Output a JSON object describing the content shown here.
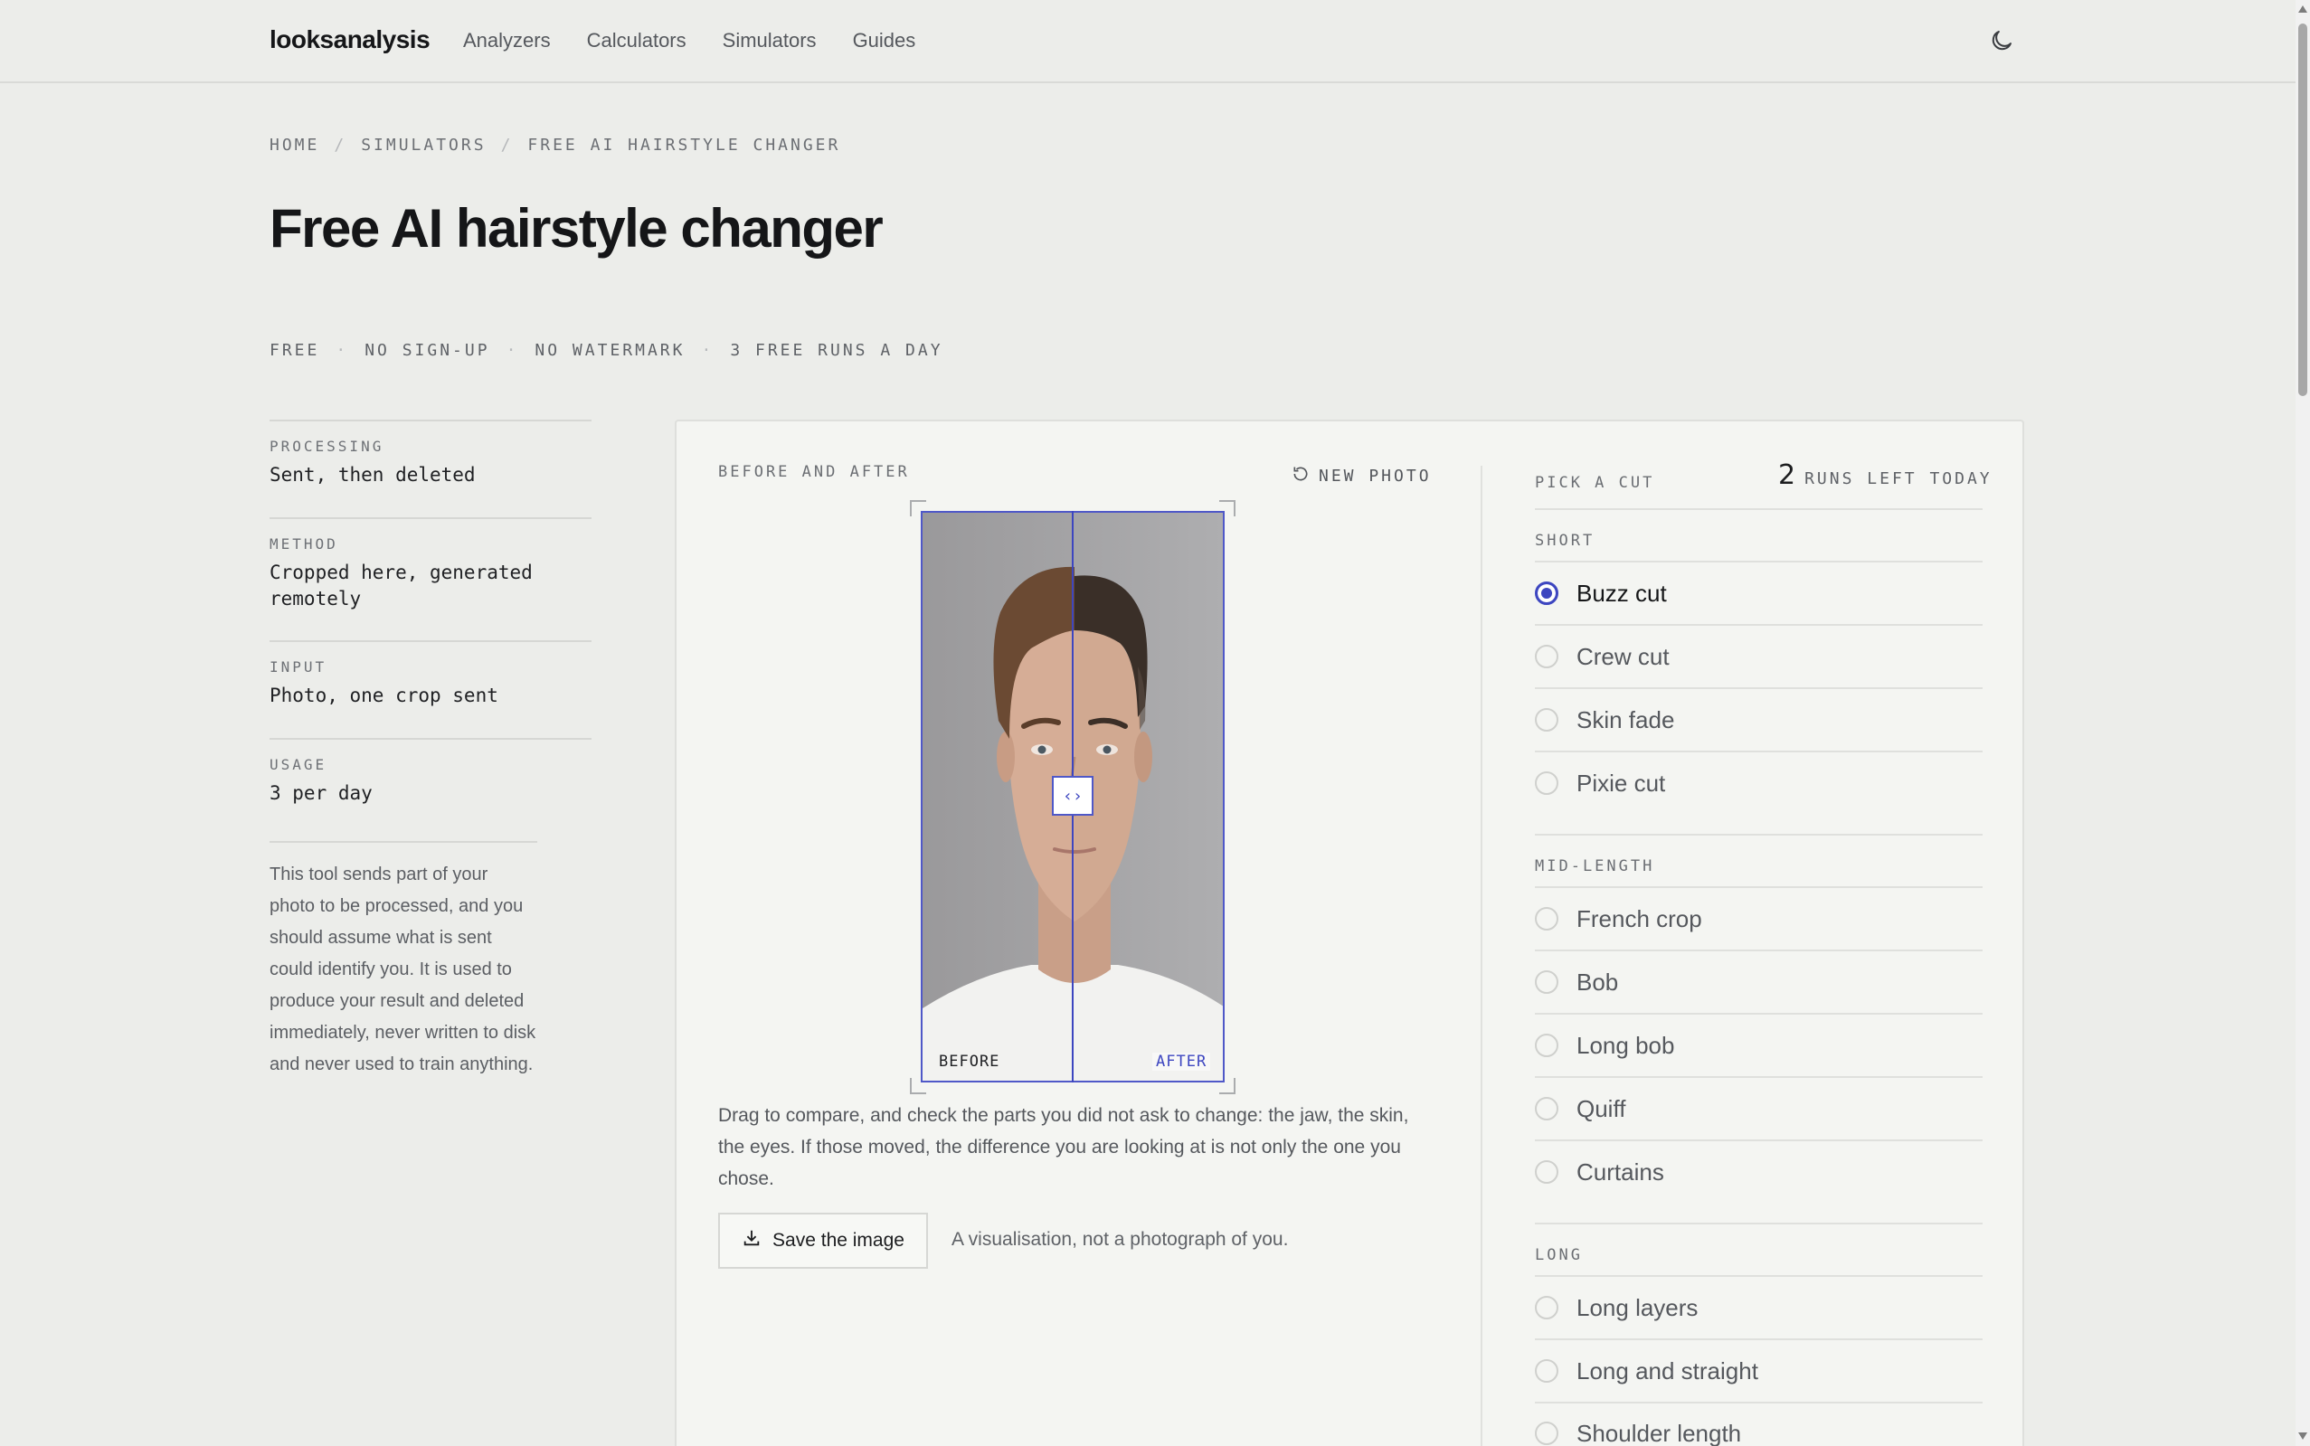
{
  "nav": {
    "logo": "looksanalysis",
    "links": [
      "Analyzers",
      "Calculators",
      "Simulators",
      "Guides"
    ]
  },
  "breadcrumb": [
    "HOME",
    "SIMULATORS",
    "FREE AI HAIRSTYLE CHANGER"
  ],
  "page": {
    "title": "Free AI hairstyle changer",
    "taglines": [
      "FREE",
      "NO SIGN-UP",
      "NO WATERMARK",
      "3 FREE RUNS A DAY"
    ]
  },
  "facts": [
    {
      "label": "PROCESSING",
      "value": "Sent, then deleted"
    },
    {
      "label": "METHOD",
      "value": "Cropped here, generated remotely"
    },
    {
      "label": "INPUT",
      "value": "Photo, one crop sent"
    },
    {
      "label": "USAGE",
      "value": "3 per day"
    }
  ],
  "privacy_note": "This tool sends part of your photo to be processed, and you should assume what is sent could identify you. It is used to produce your result and deleted immediately, never written to disk and never used to train anything.",
  "compare": {
    "section_label": "BEFORE AND AFTER",
    "new_photo_label": "NEW PHOTO",
    "before_tag": "BEFORE",
    "after_tag": "AFTER",
    "handle_glyph": "‹›",
    "slider_position": 0.5,
    "note": "Drag to compare, and check the parts you did not ask to change: the jaw, the skin, the eyes. If those moved, the difference you are looking at is not only the one you chose.",
    "save_label": "Save the image",
    "disclaimer": "A visualisation, not a photograph of you."
  },
  "picker": {
    "section_label": "PICK A CUT",
    "runs_count": "2",
    "runs_text": "RUNS LEFT TODAY",
    "groups": [
      {
        "label": "SHORT",
        "options": [
          "Buzz cut",
          "Crew cut",
          "Skin fade",
          "Pixie cut"
        ]
      },
      {
        "label": "MID-LENGTH",
        "options": [
          "French crop",
          "Bob",
          "Long bob",
          "Quiff",
          "Curtains"
        ]
      },
      {
        "label": "LONG",
        "options": [
          "Long layers",
          "Long and straight",
          "Shoulder length"
        ]
      }
    ],
    "selected": "Buzz cut"
  },
  "colors": {
    "accent": "#3d46c0",
    "background": "#ecedea",
    "card": "#f4f5f2"
  }
}
